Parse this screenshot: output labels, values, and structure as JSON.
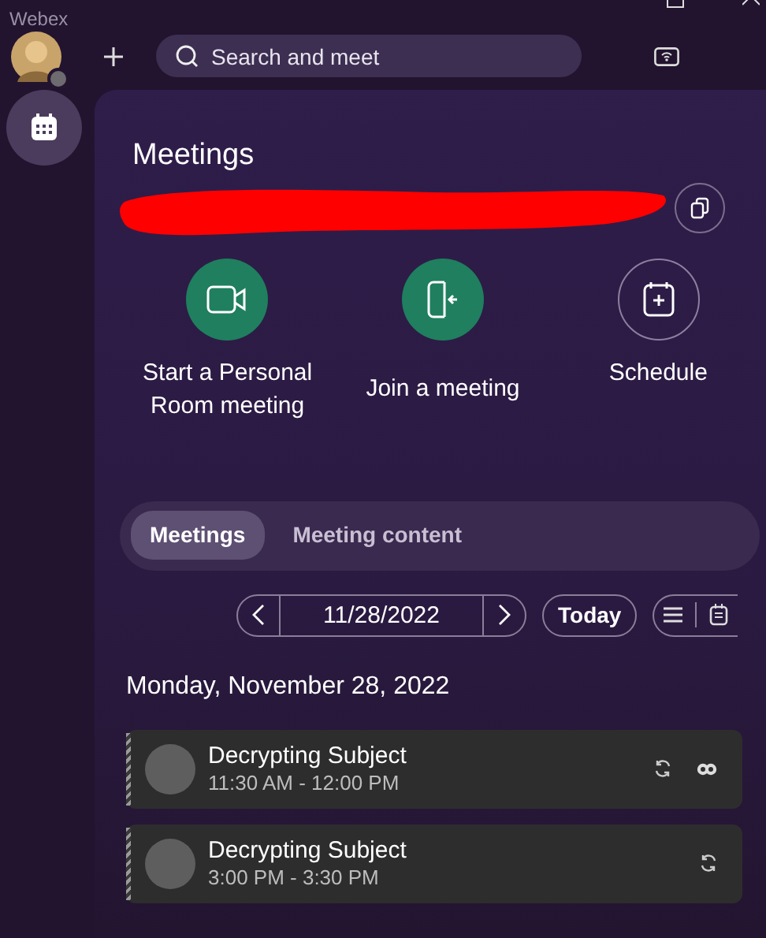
{
  "window": {
    "title": "Webex"
  },
  "search": {
    "placeholder": "Search and meet"
  },
  "meetings": {
    "title": "Meetings",
    "actions": [
      {
        "label": "Start a Personal Room meeting",
        "kind": "video"
      },
      {
        "label": "Join a meeting",
        "kind": "join"
      },
      {
        "label": "Schedule",
        "kind": "schedule"
      }
    ]
  },
  "tabs": [
    {
      "label": "Meetings",
      "selected": true
    },
    {
      "label": "Meeting content",
      "selected": false
    }
  ],
  "date_nav": {
    "date": "11/28/2022",
    "today": "Today"
  },
  "day_heading": "Monday, November 28, 2022",
  "events": [
    {
      "title": "Decrypting Subject",
      "time": "11:30 AM - 12:00 PM",
      "recurring": true,
      "webex": true
    },
    {
      "title": "Decrypting Subject",
      "time": "3:00 PM - 3:30 PM",
      "recurring": true,
      "webex": false
    }
  ]
}
